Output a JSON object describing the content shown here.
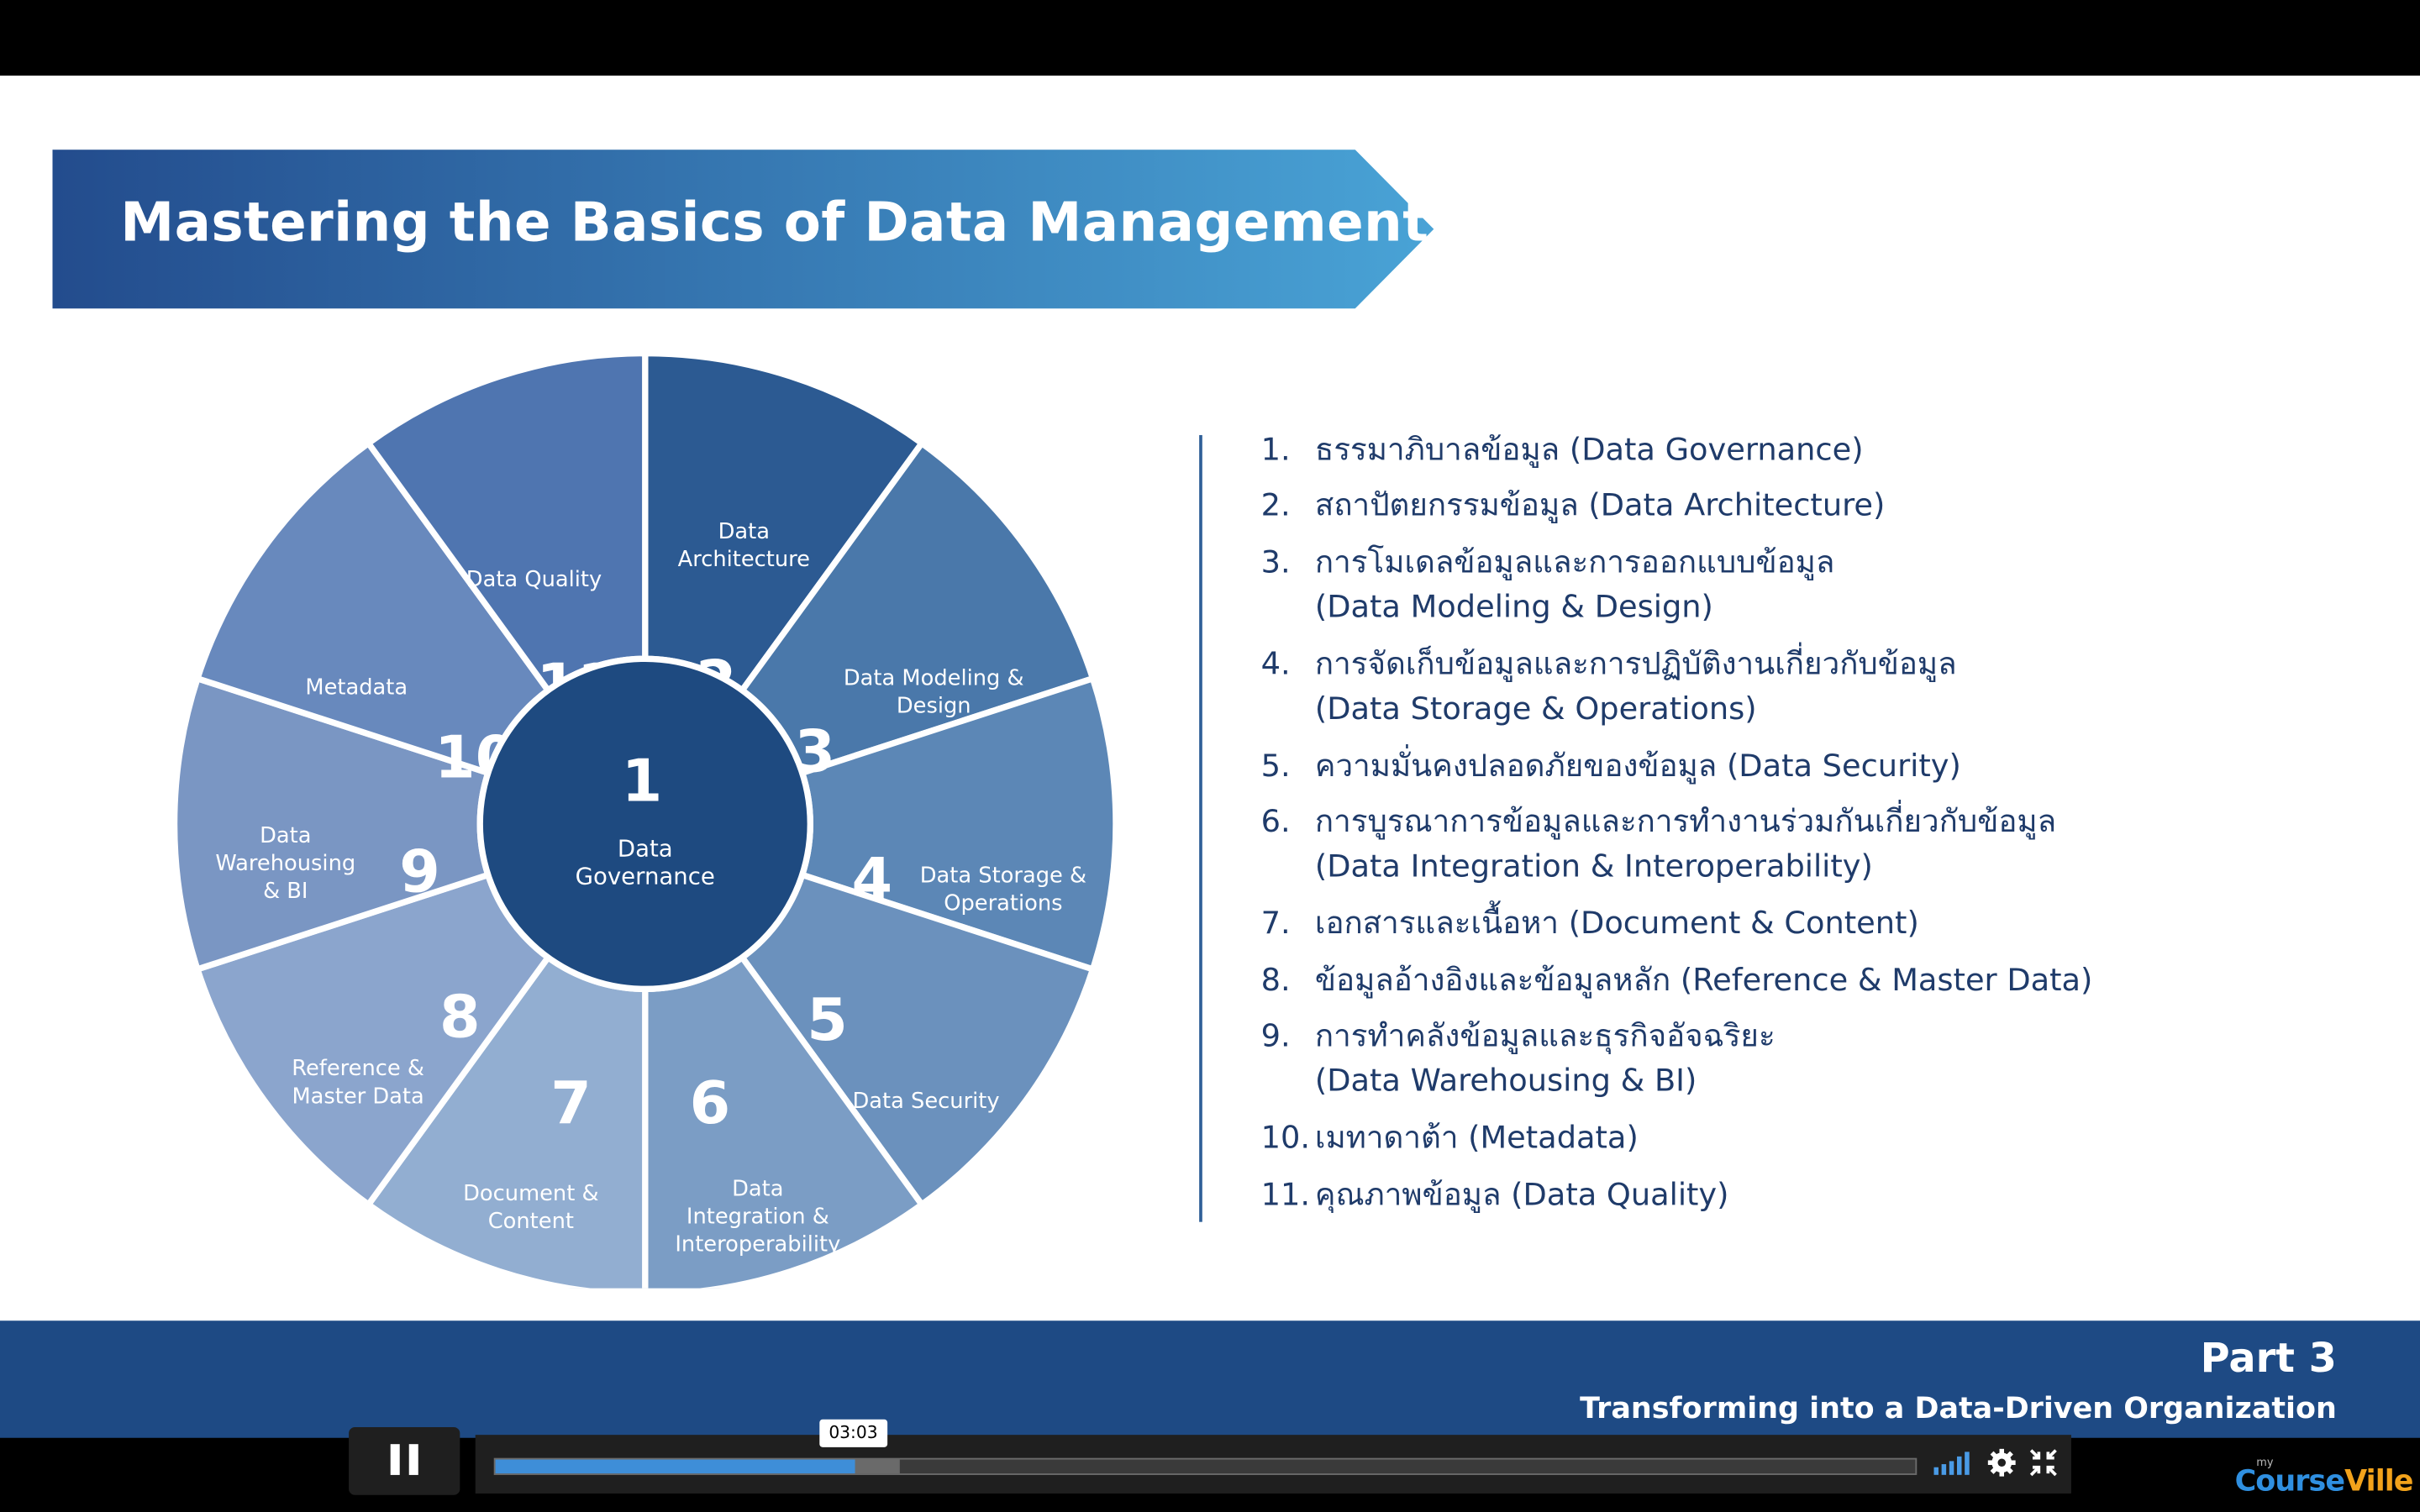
{
  "slide": {
    "title": "Mastering the Basics of Data Management",
    "center": {
      "number": "1",
      "label_line1": "Data",
      "label_line2": "Governance"
    },
    "segments": [
      {
        "number": "2",
        "lines": [
          "Data",
          "Architecture"
        ]
      },
      {
        "number": "3",
        "lines": [
          "Data Modeling &",
          "Design"
        ]
      },
      {
        "number": "4",
        "lines": [
          "Data Storage &",
          "Operations"
        ]
      },
      {
        "number": "5",
        "lines": [
          "Data Security"
        ]
      },
      {
        "number": "6",
        "lines": [
          "Data",
          "Integration &",
          "Interoperability"
        ]
      },
      {
        "number": "7",
        "lines": [
          "Document &",
          "Content"
        ]
      },
      {
        "number": "8",
        "lines": [
          "Reference &",
          "Master Data"
        ]
      },
      {
        "number": "9",
        "lines": [
          "Data",
          "Warehousing",
          "& BI"
        ]
      },
      {
        "number": "10",
        "lines": [
          "Metadata"
        ]
      },
      {
        "number": "11",
        "lines": [
          "Data Quality"
        ]
      }
    ],
    "list": [
      {
        "num": "1.",
        "text": "ธรรมาภิบาลข้อมูล (Data Governance)",
        "sub": ""
      },
      {
        "num": "2.",
        "text": "สถาปัตยกรรมข้อมูล (Data Architecture)",
        "sub": ""
      },
      {
        "num": "3.",
        "text": "การโมเดลข้อมูลและการออกแบบข้อมูล",
        "sub": "(Data Modeling & Design)"
      },
      {
        "num": "4.",
        "text": "การจัดเก็บข้อมูลและการปฏิบัติงานเกี่ยวกับข้อมูล",
        "sub": "(Data Storage & Operations)"
      },
      {
        "num": "5.",
        "text": "ความมั่นคงปลอดภัยของข้อมูล (Data Security)",
        "sub": ""
      },
      {
        "num": "6.",
        "text": "การบูรณาการข้อมูลและการทำงานร่วมกันเกี่ยวกับข้อมูล",
        "sub": "(Data Integration & Interoperability)"
      },
      {
        "num": "7.",
        "text": "เอกสารและเนื้อหา (Document & Content)",
        "sub": ""
      },
      {
        "num": "8.",
        "text": "ข้อมูลอ้างอิงและข้อมูลหลัก (Reference & Master Data)",
        "sub": ""
      },
      {
        "num": "9.",
        "text": "การทำคลังข้อมูลและธุรกิจอัจฉริยะ",
        "sub": "(Data Warehousing & BI)"
      },
      {
        "num": "10.",
        "text": "เมทาดาต้า (Metadata)",
        "sub": ""
      },
      {
        "num": "11.",
        "text": "คุณภาพข้อมูล (Data Quality)",
        "sub": ""
      }
    ],
    "part_label": "Part 3",
    "part_subtitle": "Transforming into a Data-Driven Organization"
  },
  "player": {
    "current_time": "03:03",
    "progress": 0.253,
    "buffered": 0.285,
    "icons": {
      "play_pause": "pause-icon",
      "volume": "volume-icon",
      "settings": "gear-icon",
      "fullscreen": "exit-fullscreen-icon"
    }
  },
  "brand": {
    "small": "my",
    "course": "Course",
    "ville": "Ville",
    "course_color": "#2f8fe0",
    "ville_color": "#f2a21b"
  },
  "colors": {
    "banner_start": "#234c8d",
    "banner_end": "#49a3d6",
    "center": "#1e4a80",
    "band": "#1e4a84",
    "list_text": "#1f3b6a",
    "progress": "#3e8ed8",
    "segments": [
      "#25528a",
      "#315f96",
      "#4876aa",
      "#5f89b8",
      "#7897c3",
      "#90a9ce",
      "#889fca",
      "#7a93c2",
      "#6889bd",
      "#5379b3",
      "#3a63a8",
      "#2d58a6"
    ]
  }
}
